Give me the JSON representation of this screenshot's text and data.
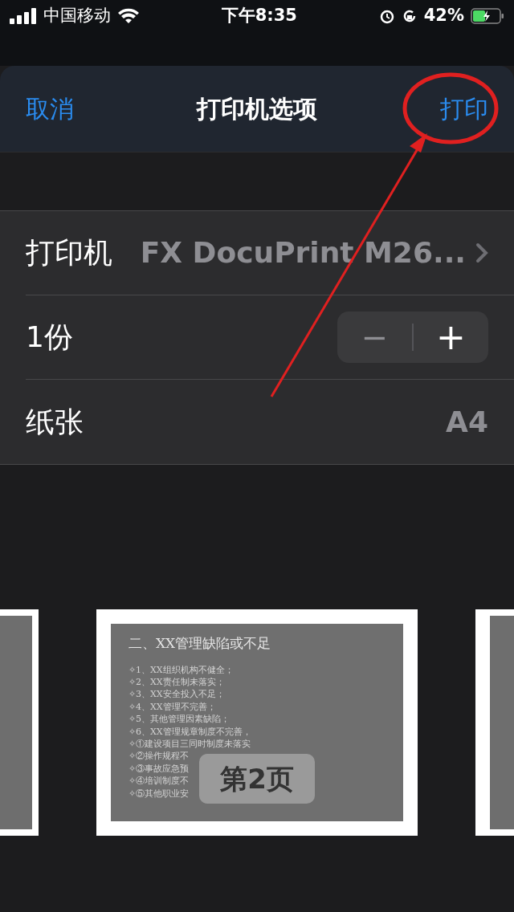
{
  "status_bar": {
    "carrier": "中国移动",
    "time": "下午8:35",
    "battery": "42%"
  },
  "sheet": {
    "cancel": "取消",
    "title": "打印机选项",
    "print": "打印"
  },
  "options": [
    {
      "kind": "link",
      "label": "打印机",
      "value": "FX DocuPrint M26..."
    },
    {
      "kind": "stepper",
      "label": "1份",
      "minus": "−",
      "plus": "+"
    },
    {
      "kind": "value",
      "label": "纸张",
      "value": "A4"
    }
  ],
  "preview": {
    "title": "二、XX管理缺陷或不足",
    "lines": [
      "✧1、XX组织机构不健全；",
      "✧2、XX责任制未落实；",
      "✧3、XX安全投入不足；",
      "✧4、XX管理不完善；",
      "✧5、其他管理因素缺陷；",
      "✧6、XX管理规章制度不完善，",
      "✧①建设项目三同时制度未落实",
      "✧②操作规程不",
      "✧③事故应急预",
      "✧④培训制度不",
      "✧⑤其他职业安"
    ],
    "page_label": "第2页"
  }
}
